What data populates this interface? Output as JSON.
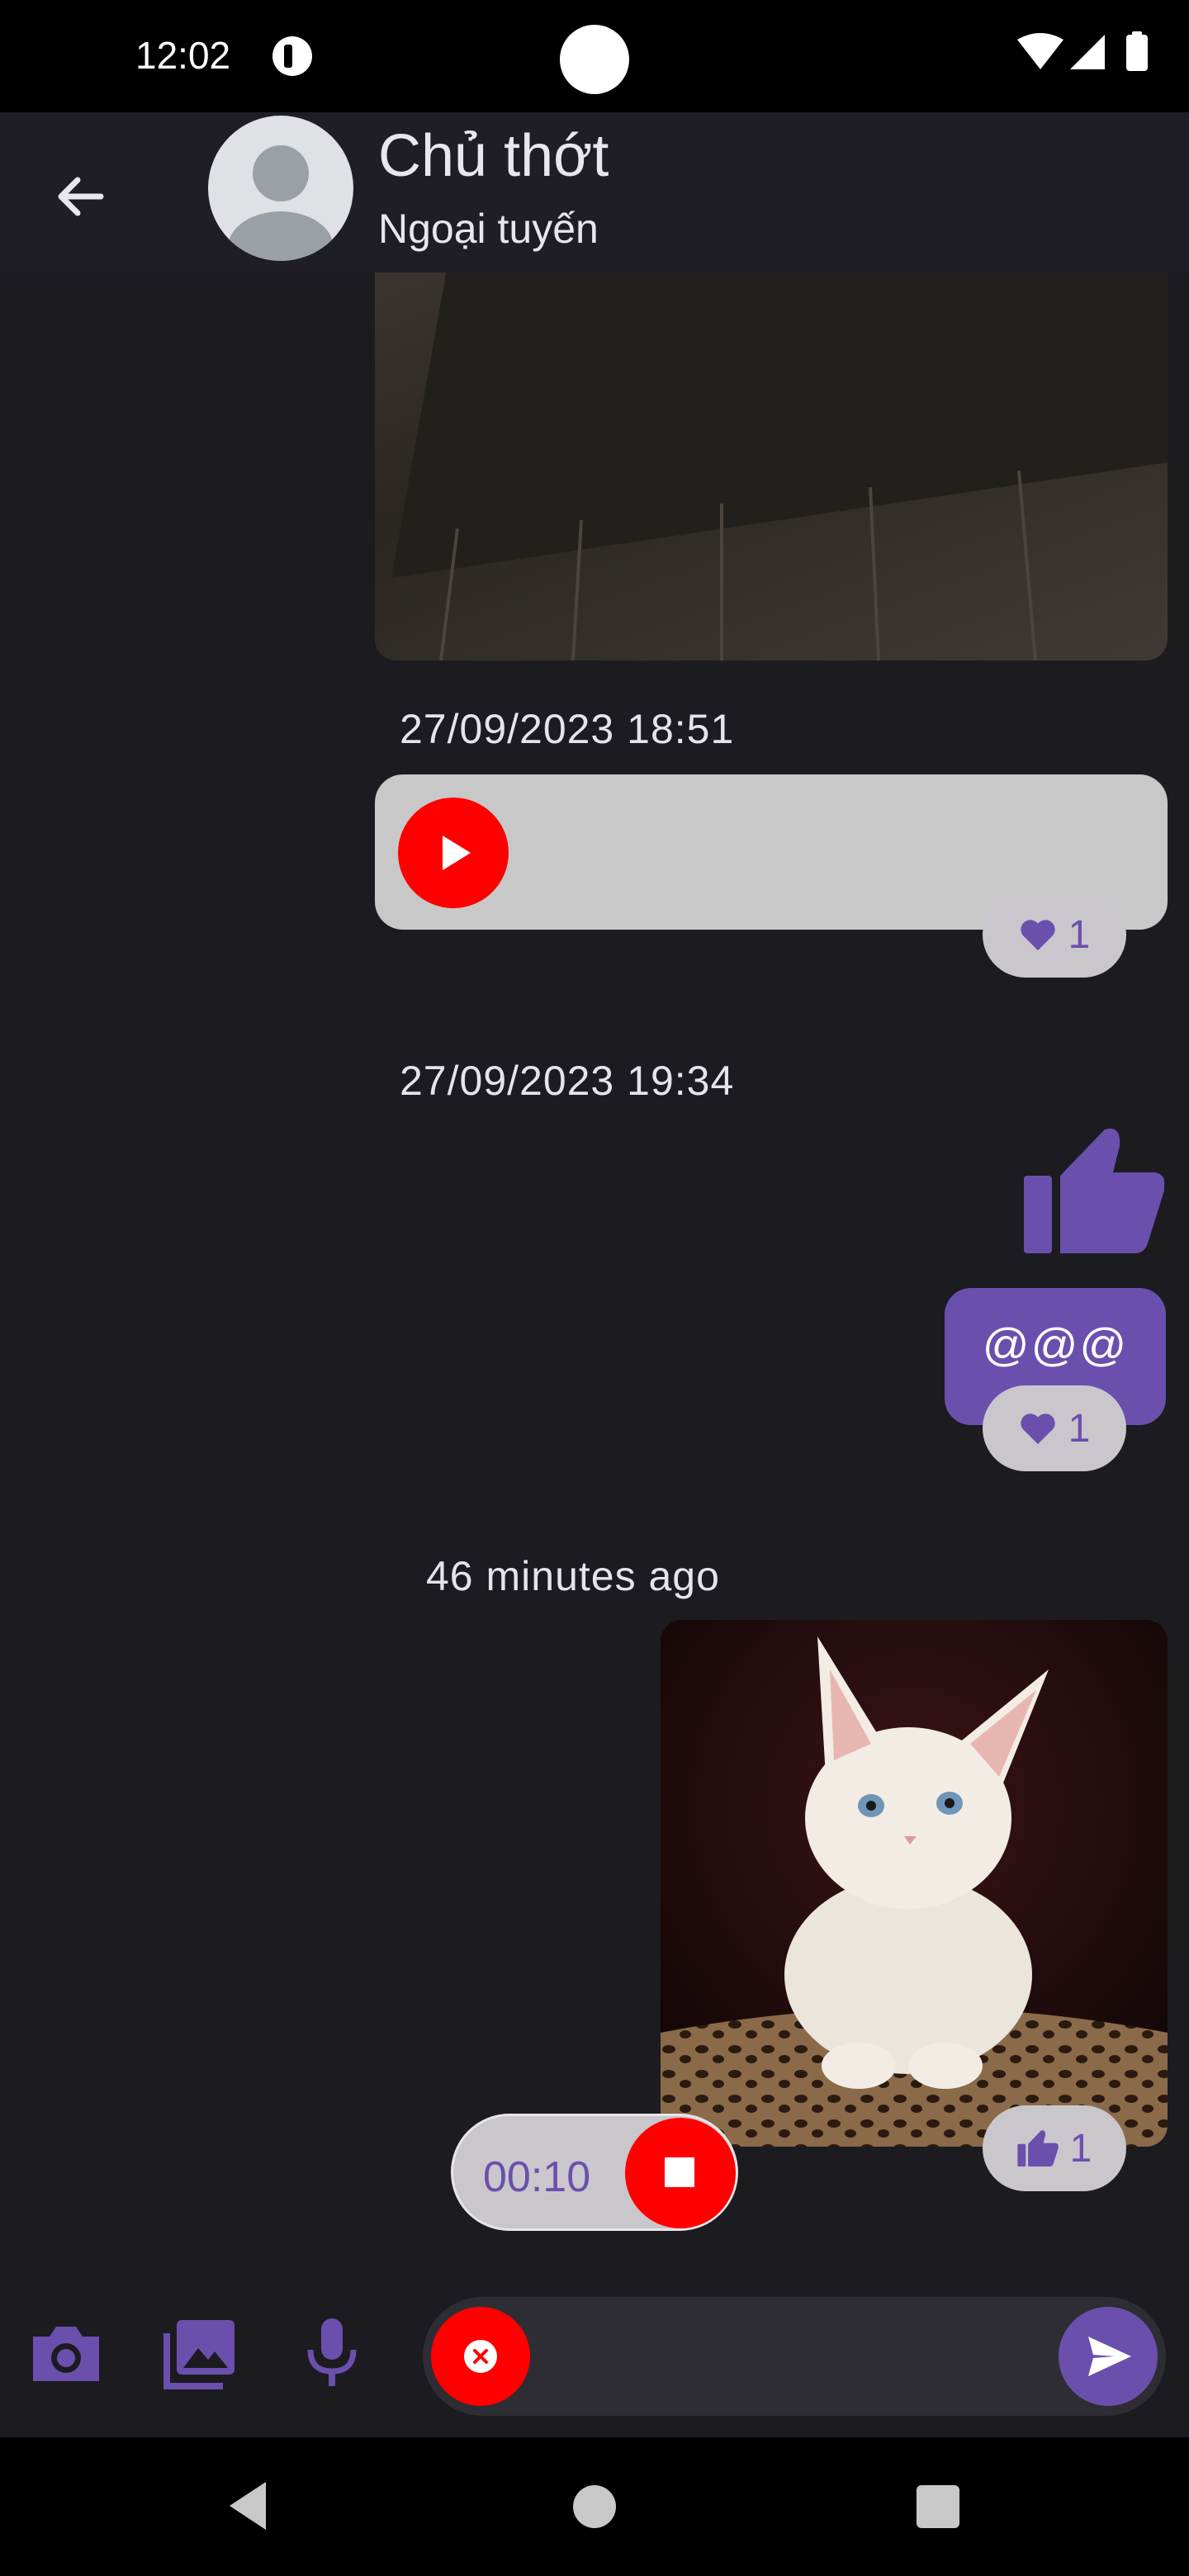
{
  "status_bar": {
    "time": "12:02"
  },
  "header": {
    "title": "Chủ thớt",
    "subtitle": "Ngoại tuyến"
  },
  "messages": {
    "timestamp_1": "27/09/2023 18:51",
    "audio_reaction_count": "1",
    "timestamp_2": "27/09/2023 19:34",
    "text_message": "@@@",
    "text_reaction_count": "1",
    "timestamp_3": "46 minutes ago",
    "photo_reaction_count": "1"
  },
  "recording": {
    "elapsed": "00:10"
  },
  "colors": {
    "accent": "#6b4fad",
    "record_red": "#ff0000",
    "background": "#1c1b20"
  },
  "icons": [
    "back-arrow-icon",
    "avatar-icon",
    "play-icon",
    "heart-icon",
    "thumbs-up-icon",
    "stop-icon",
    "camera-icon",
    "gallery-icon",
    "microphone-icon",
    "close-icon",
    "send-icon"
  ]
}
